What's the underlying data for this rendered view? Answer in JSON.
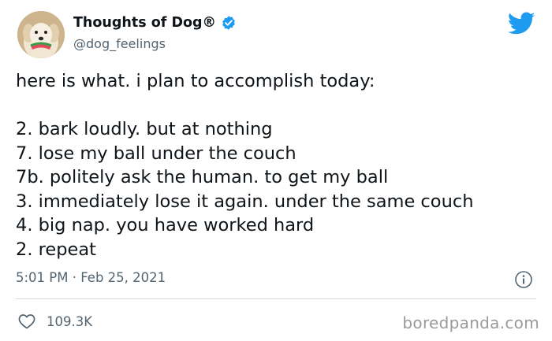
{
  "author": {
    "display_name": "Thoughts of Dog®",
    "handle": "@dog_feelings",
    "avatar": "dog-with-watermelon-avatar",
    "verified_icon": "verified-badge-icon"
  },
  "logo": "twitter-bird-icon",
  "tweet": {
    "lines": [
      "here is what. i plan to accomplish today:",
      "",
      "2. bark loudly. but at nothing",
      "7. lose my ball under the couch",
      "7b. politely ask the human. to get my ball",
      "3. immediately lose it again. under the same couch",
      "4. big nap. you have worked hard",
      "2. repeat"
    ],
    "timestamp": "5:01 PM · Feb 25, 2021"
  },
  "engagement": {
    "like_icon": "heart-icon",
    "like_count": "109.3K",
    "info_icon": "info-icon"
  },
  "watermark": "boredpanda.com",
  "colors": {
    "accent": "#1d9bf0",
    "text": "#0f1419",
    "secondary_text": "#536471",
    "divider": "#cfd9de",
    "watermark": "#9a9a9a"
  }
}
